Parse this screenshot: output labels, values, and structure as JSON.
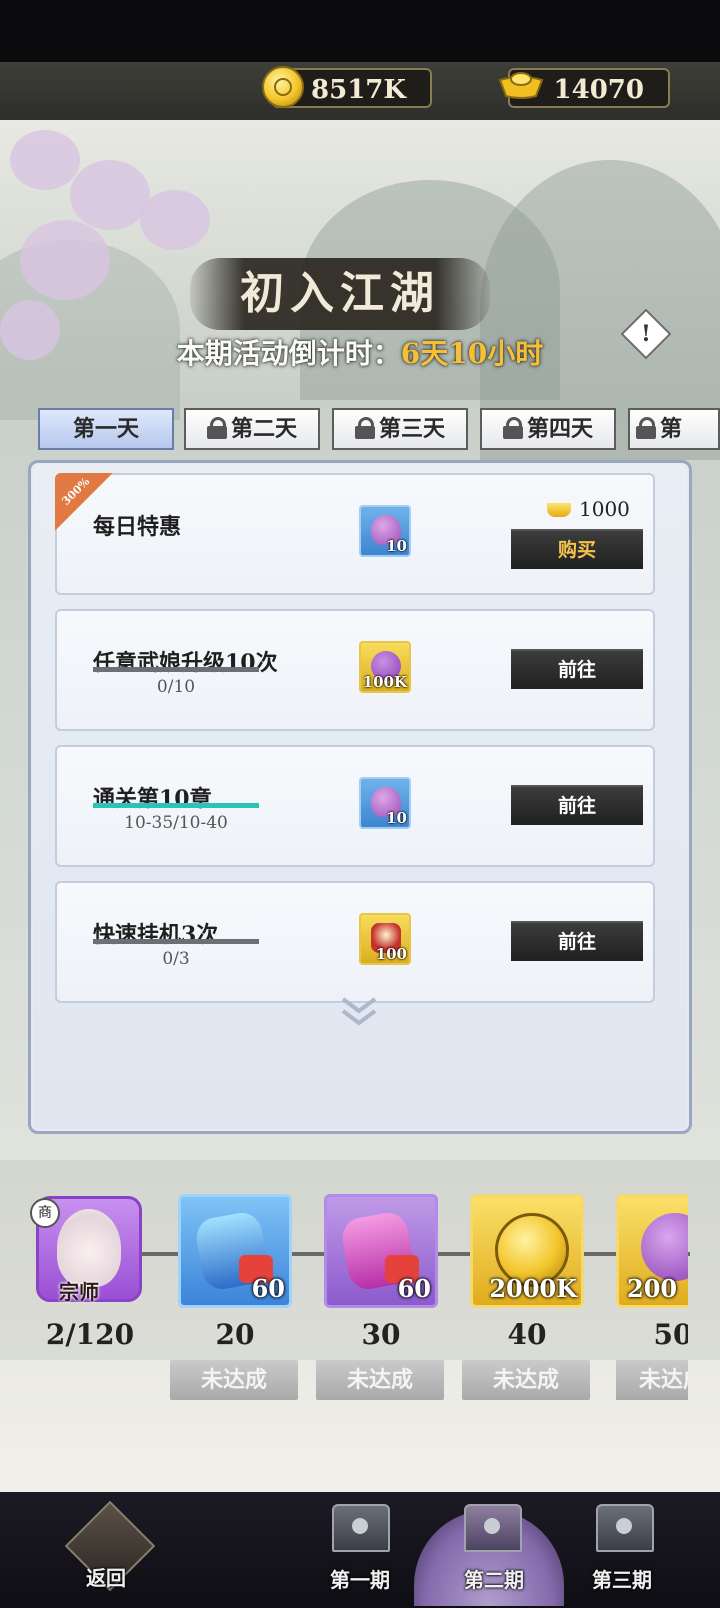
{
  "currency": {
    "coins": "8517K",
    "ingots": "14070"
  },
  "event": {
    "title": "初入江湖",
    "countdown_label": "本期活动倒计时：",
    "countdown_value": "6天10小时"
  },
  "days": [
    {
      "label": "第一天",
      "locked": false,
      "active": true
    },
    {
      "label": "第二天",
      "locked": true
    },
    {
      "label": "第三天",
      "locked": true
    },
    {
      "label": "第四天",
      "locked": true
    },
    {
      "label": "第",
      "locked": true
    }
  ],
  "tasks": [
    {
      "name": "每日特惠",
      "ribbon": "300%",
      "reward_qty": "10",
      "reward_icon": "purple-stone-icon",
      "price": "1000",
      "button": "购买"
    },
    {
      "name": "任意武娘升级10次",
      "progress": "0/10",
      "progress_ratio": 0,
      "reward_qty": "100K",
      "reward_icon": "star-coin-icon",
      "button": "前往"
    },
    {
      "name": "通关第10章",
      "progress": "10-35/10-40",
      "progress_ratio": 1,
      "reward_qty": "10",
      "reward_icon": "purple-stone-icon",
      "button": "前往"
    },
    {
      "name": "快速挂机3次",
      "progress": "0/3",
      "progress_ratio": 0,
      "reward_qty": "100",
      "reward_icon": "hourglass-icon",
      "button": "前往"
    }
  ],
  "milestones": {
    "avatar_badge": "宗师",
    "avatar_tag": "商",
    "progress": "2/120",
    "items": [
      {
        "points": "20",
        "qty": "60",
        "kind": "blue",
        "status": "未达成"
      },
      {
        "points": "30",
        "qty": "60",
        "kind": "purple",
        "status": "未达成"
      },
      {
        "points": "40",
        "qty": "2000K",
        "kind": "gold",
        "status": "未达成"
      },
      {
        "points": "50",
        "qty": "200",
        "kind": "gold",
        "status": "未达成"
      }
    ]
  },
  "nav": {
    "back": "返回",
    "period1": "第一期",
    "period2": "第二期",
    "period3": "第三期"
  },
  "colors": {
    "accent_gold": "#f5c035",
    "progress_teal": "#2dc2b8",
    "button_dark": "#1f1f1f"
  }
}
